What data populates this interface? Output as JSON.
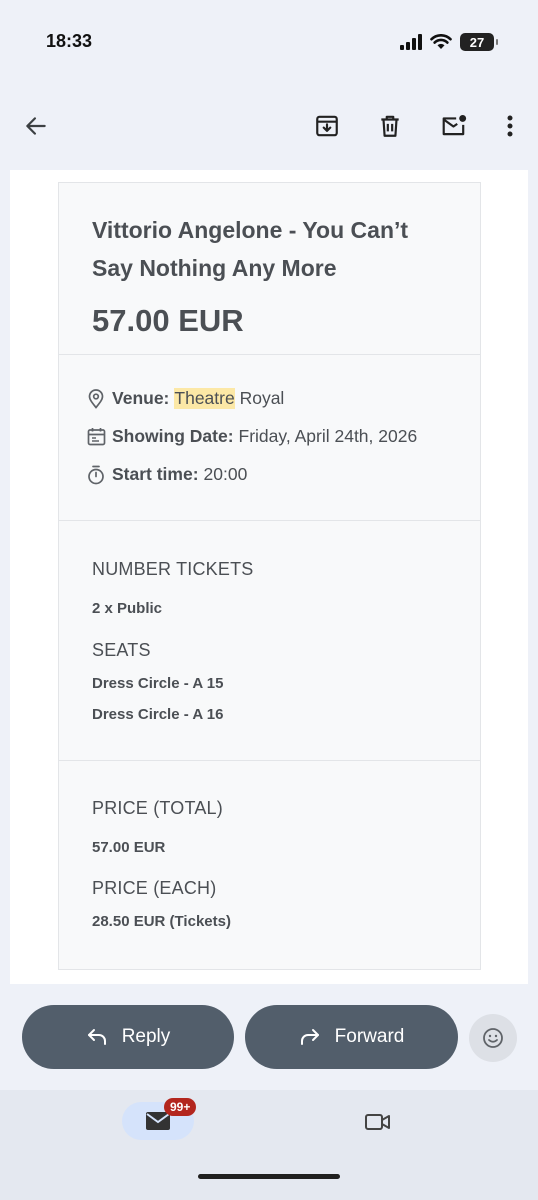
{
  "status_bar": {
    "time": "18:33",
    "battery": "27"
  },
  "toolbar": {
    "back_icon": "arrow-left-icon",
    "archive_icon": "archive-icon",
    "delete_icon": "trash-icon",
    "unread_icon": "mark-unread-icon",
    "more_icon": "more-vertical-icon"
  },
  "ticket": {
    "title": "Vittorio Angelone - You Can’t Say Nothing Any More",
    "price": "57.00 EUR",
    "venue_label": "Venue:",
    "venue_highlight": "Theatre",
    "venue_rest": "Royal",
    "date_label": "Showing Date:",
    "date_value": "Friday, April 24th, 2026",
    "time_label": "Start time:",
    "time_value": "20:00",
    "number_tickets_label": "NUMBER TICKETS",
    "number_tickets_value": "2 x Public",
    "seats_label": "SEATS",
    "seats": [
      "Dress Circle - A 15",
      "Dress Circle - A 16"
    ],
    "price_total_label": "PRICE (TOTAL)",
    "price_total_value": "57.00 EUR",
    "price_each_label": "PRICE (EACH)",
    "price_each_value": "28.50 EUR (Tickets)"
  },
  "actions": {
    "reply": "Reply",
    "forward": "Forward"
  },
  "bottom_nav": {
    "mail_badge": "99+"
  },
  "colors": {
    "action_button": "#525e6b",
    "highlight": "#fce8a6",
    "badge": "#b3261e"
  }
}
